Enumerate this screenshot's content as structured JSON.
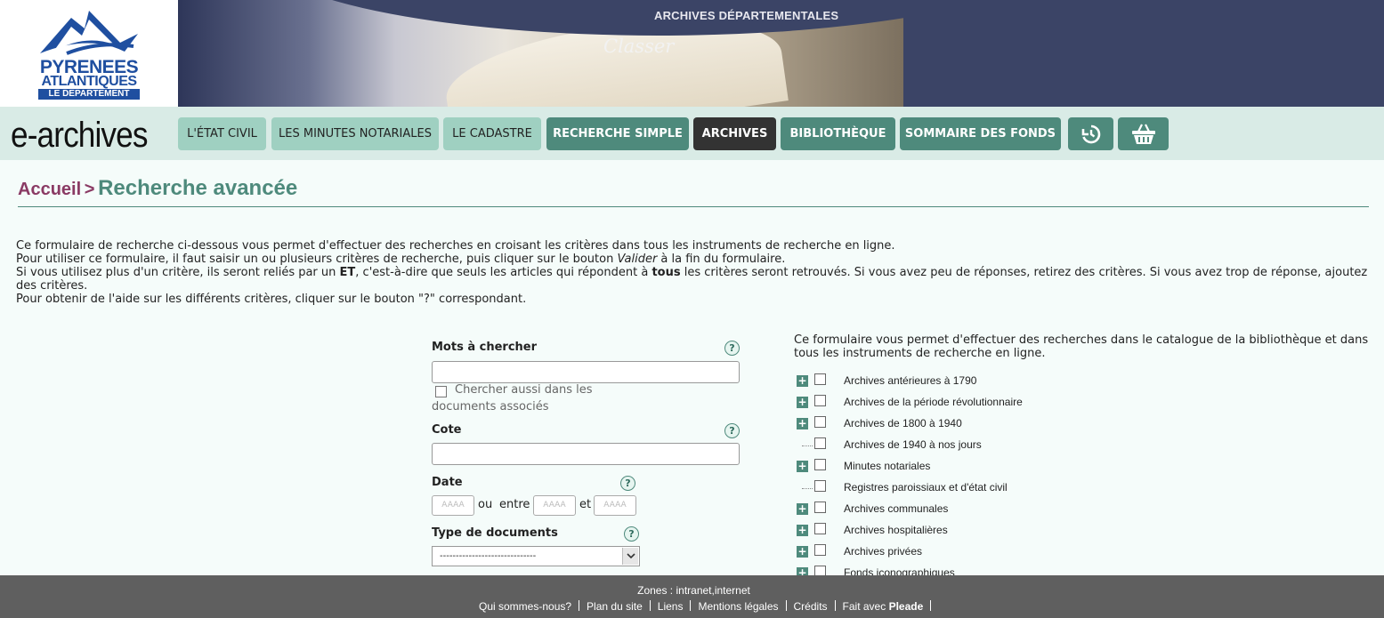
{
  "header": {
    "logo": {
      "line1": "PYRENEES",
      "line2": "ATLANTIQUES",
      "line3": "LE DEPARTEMENT"
    },
    "banner_title": "ARCHIVES DÉPARTEMENTALES",
    "banner_subtitle": "Classer"
  },
  "nav": {
    "brand": "e-archives",
    "items": [
      {
        "label": "L'ÉTAT CIVIL"
      },
      {
        "label": "LES MINUTES NOTARIALES"
      },
      {
        "label": "LE CADASTRE"
      },
      {
        "label": "RECHERCHE SIMPLE"
      },
      {
        "label": "ARCHIVES"
      },
      {
        "label": "BIBLIOTHÈQUE"
      },
      {
        "label": "SOMMAIRE DES FONDS"
      }
    ],
    "icons": [
      "history-icon",
      "basket-icon"
    ],
    "active": "ARCHIVES"
  },
  "breadcrumb": {
    "home": "Accueil",
    "separator": ">",
    "current": "Recherche avancée"
  },
  "intro": {
    "line1": "Ce formulaire de recherche ci-dessous vous permet d'effectuer des recherches en croisant les critères dans tous les instruments de recherche en ligne.",
    "line2_a": "Pour utiliser ce formulaire, il faut saisir un ou plusieurs critères de recherche, puis cliquer sur le bouton ",
    "line2_em": "Valider",
    "line2_b": " à la fin du formulaire.",
    "line3_a": "Si vous utilisez plus d'un critère, ils seront reliés par un ",
    "line3_strong1": "ET",
    "line3_b": ", c'est-à-dire que seuls les articles qui répondent à ",
    "line3_strong2": "tous",
    "line3_c": " les critères seront retrouvés. Si vous avez peu de réponses, retirez des critères. Si vous avez trop de réponse, ajoutez des critères.",
    "line4": "Pour obtenir de l'aide sur les différents critères, cliquer sur le bouton \"?\" correspondant."
  },
  "form": {
    "help": "?",
    "keywords": {
      "label": "Mots à chercher",
      "value": "",
      "also_search_label": "Chercher aussi dans les documents associés"
    },
    "cote": {
      "label": "Cote",
      "value": ""
    },
    "date": {
      "label": "Date",
      "placeholder": "AAAA",
      "or": "ou",
      "between": "entre",
      "and": "et"
    },
    "doctype": {
      "label": "Type de documents",
      "selected": "------------------------------"
    }
  },
  "tree": {
    "intro": "Ce formulaire vous permet d'effectuer des recherches dans le catalogue de la bibliothèque et dans tous les instruments de recherche en ligne.",
    "items": [
      {
        "label": "Archives antérieures à 1790",
        "expandable": "+"
      },
      {
        "label": "Archives de la période révolutionnaire",
        "expandable": "+"
      },
      {
        "label": "Archives de 1800 à 1940",
        "expandable": "+"
      },
      {
        "label": "Archives de 1940 à nos jours",
        "expandable": ""
      },
      {
        "label": "Minutes notariales",
        "expandable": "+"
      },
      {
        "label": "Registres paroissiaux et d'état civil",
        "expandable": ""
      },
      {
        "label": "Archives communales",
        "expandable": "+"
      },
      {
        "label": "Archives hospitalières",
        "expandable": "+"
      },
      {
        "label": "Archives privées",
        "expandable": "+"
      },
      {
        "label": "Fonds iconographiques",
        "expandable": "+"
      }
    ]
  },
  "footer": {
    "zones": "Zones : intranet,internet",
    "links": [
      "Qui sommes-nous?",
      "Plan du site",
      "Liens",
      "Mentions légales",
      "Crédits"
    ],
    "made_with_prefix": "Fait avec ",
    "made_with_name": "Pleade"
  }
}
